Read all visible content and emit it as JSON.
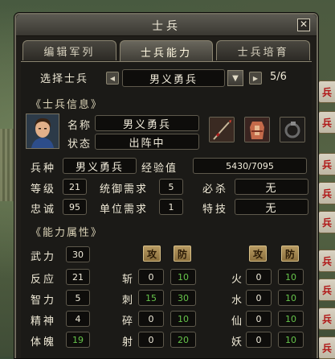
{
  "window": {
    "title": "士兵"
  },
  "tabs": [
    {
      "label": "编辑军列"
    },
    {
      "label": "士兵能力"
    },
    {
      "label": "士兵培育"
    }
  ],
  "selector": {
    "label": "选择士兵",
    "selected": "男义勇兵",
    "page": "5/6"
  },
  "info": {
    "section_title": "《士兵信息》",
    "name_label": "名称",
    "name_value": "男义勇兵",
    "state_label": "状态",
    "state_value": "出阵中",
    "type_label": "兵种",
    "type_value": "男义勇兵",
    "exp_label": "经验值",
    "exp_value": "5430/7095",
    "level_label": "等级",
    "level_value": "21",
    "cmd_label": "统御需求",
    "cmd_value": "5",
    "kill_label": "必杀",
    "kill_value": "无",
    "loyalty_label": "忠诚",
    "loyalty_value": "95",
    "unit_label": "单位需求",
    "unit_value": "1",
    "skill_label": "特技",
    "skill_value": "无"
  },
  "ability": {
    "section_title": "《能力属性》",
    "atk_label": "攻",
    "def_label": "防",
    "stats": [
      {
        "label": "武力",
        "value": "30",
        "value_color": "white"
      },
      {
        "label": "反应",
        "value": "21",
        "value_color": "white"
      },
      {
        "label": "智力",
        "value": "5",
        "value_color": "white"
      },
      {
        "label": "精神",
        "value": "4",
        "value_color": "white"
      },
      {
        "label": "体魄",
        "value": "19",
        "value_color": "green"
      }
    ],
    "weapons": [
      {
        "label": "斩",
        "atk": "0",
        "def": "10"
      },
      {
        "label": "刺",
        "atk": "15",
        "def": "30"
      },
      {
        "label": "碎",
        "atk": "0",
        "def": "10"
      },
      {
        "label": "射",
        "atk": "0",
        "def": "20"
      }
    ],
    "elements": [
      {
        "label": "火",
        "atk": "0",
        "def": "10"
      },
      {
        "label": "水",
        "atk": "0",
        "def": "10"
      },
      {
        "label": "仙",
        "atk": "0",
        "def": "10"
      },
      {
        "label": "妖",
        "atk": "0",
        "def": "10"
      }
    ]
  },
  "side_tags": [
    "兵",
    "兵",
    "兵",
    "兵",
    "兵",
    "兵",
    "兵",
    "兵",
    "兵"
  ],
  "colors": {
    "green_value": "#66c44a",
    "panel": "#1b1a17"
  }
}
